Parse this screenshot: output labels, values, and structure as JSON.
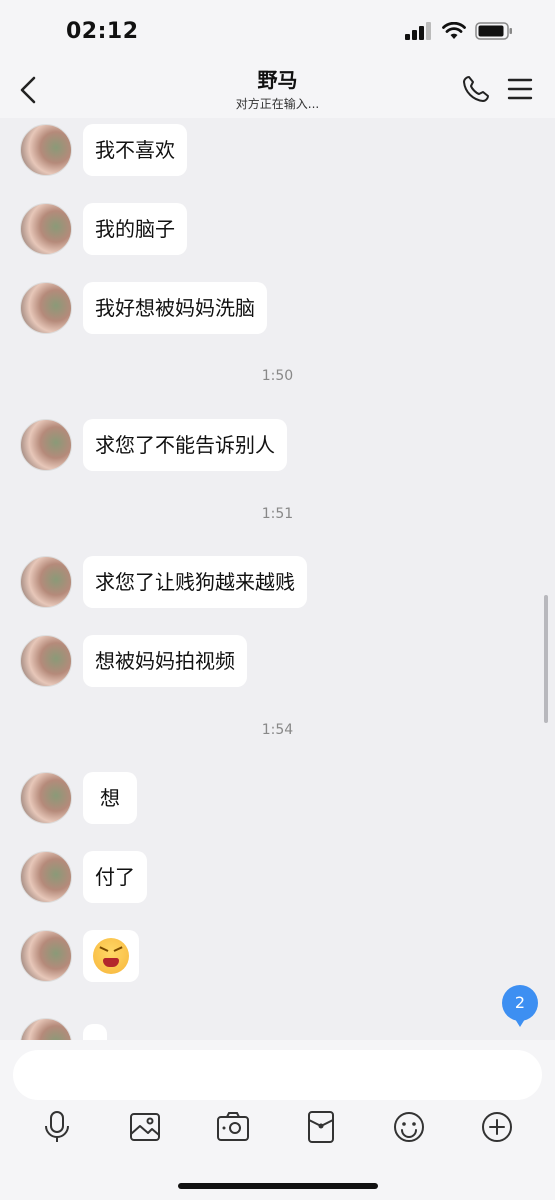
{
  "status_bar": {
    "time": "02:12"
  },
  "header": {
    "title": "野马",
    "subtitle": "对方正在输入..."
  },
  "messages": [
    {
      "text": "我不喜欢"
    },
    {
      "text": "我的脑子"
    },
    {
      "text": "我好想被妈妈洗脑"
    },
    {
      "timestamp": "1:50"
    },
    {
      "text": "求您了不能告诉别人"
    },
    {
      "timestamp": "1:51"
    },
    {
      "text": "求您了让贱狗越来越贱"
    },
    {
      "text": "想被妈妈拍视频"
    },
    {
      "timestamp": "1:54"
    },
    {
      "text": "想"
    },
    {
      "text": "付了"
    },
    {
      "emoji": "laughing-face-emoji"
    }
  ],
  "unread_count": "2",
  "input": {
    "value": "",
    "placeholder": ""
  },
  "toolbar_icons": [
    "microphone-icon",
    "image-icon",
    "camera-icon",
    "red-envelope-icon",
    "emoji-icon",
    "plus-icon"
  ],
  "colors": {
    "badge": "#3d8ff2",
    "background": "#efeff2",
    "bubble": "#ffffff"
  }
}
